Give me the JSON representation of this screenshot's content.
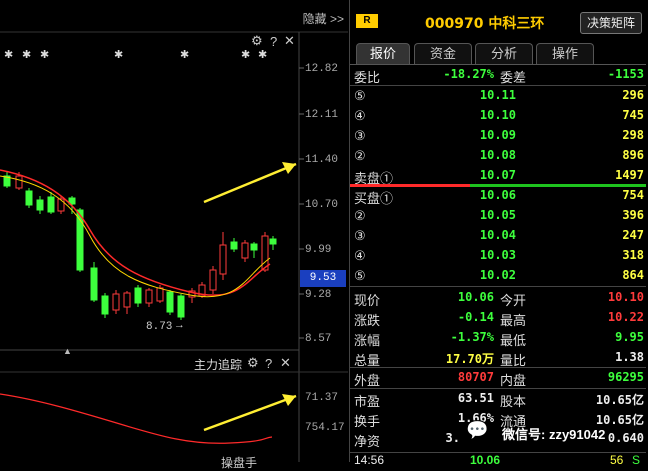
{
  "chart_panel": {
    "hide_label": "隐藏 >>",
    "y_ticks": [
      "12.82",
      "12.11",
      "11.40",
      "10.70",
      "9.99",
      "9.28",
      "8.57"
    ],
    "current_price_badge": "9.53",
    "low_label": "8.73",
    "sub_title": "主力追踪",
    "sub_ticks": [
      "71.37",
      "754.17"
    ],
    "bottom_partial": "操盘手"
  },
  "stock": {
    "badge": "R",
    "code_name": "000970 中科三环",
    "decision_button": "决策矩阵"
  },
  "tabs": [
    "报价",
    "资金",
    "分析",
    "操作"
  ],
  "commission": {
    "ratio_label": "委比",
    "ratio_value": "-18.27%",
    "diff_label": "委差",
    "diff_value": "-1153"
  },
  "sell_orders": [
    {
      "label": "⑤",
      "price": "10.11",
      "volume": "296"
    },
    {
      "label": "④",
      "price": "10.10",
      "volume": "745"
    },
    {
      "label": "③",
      "price": "10.09",
      "volume": "298"
    },
    {
      "label": "②",
      "price": "10.08",
      "volume": "896"
    },
    {
      "label": "卖盘①",
      "price": "10.07",
      "volume": "1497"
    }
  ],
  "buy_orders": [
    {
      "label": "买盘①",
      "price": "10.06",
      "volume": "754"
    },
    {
      "label": "②",
      "price": "10.05",
      "volume": "396"
    },
    {
      "label": "③",
      "price": "10.04",
      "volume": "247"
    },
    {
      "label": "④",
      "price": "10.03",
      "volume": "318"
    },
    {
      "label": "⑤",
      "price": "10.02",
      "volume": "864"
    }
  ],
  "quote": {
    "now_label": "现价",
    "now_value": "10.06",
    "open_label": "今开",
    "open_value": "10.10",
    "chg_label": "涨跌",
    "chg_value": "-0.14",
    "high_label": "最高",
    "high_value": "10.22",
    "pct_label": "涨幅",
    "pct_value": "-1.37%",
    "low_label": "最低",
    "low_value": "9.95",
    "vol_label": "总量",
    "vol_value": "17.70万",
    "vr_label": "量比",
    "vr_value": "1.38",
    "outer_label": "外盘",
    "outer_value": "80707",
    "inner_label": "内盘",
    "inner_value": "96295",
    "pe_label": "市盈",
    "pe_value": "63.51",
    "cap_label": "股本",
    "cap_value": "10.65亿",
    "turn_label": "换手",
    "turn_value": "1.66%",
    "flow_label": "流通",
    "flow_value": "10.65亿",
    "na_label": "净资",
    "na_value": "3.",
    "np_value": "0.640",
    "time_value": "14:56",
    "time_price": "10.06",
    "time_vol": "56",
    "time_flag": "S"
  },
  "watermark": "微信号: zzy91042",
  "colors": {
    "up": "#ff3b3b",
    "down": "#3dff3d",
    "ma_red": "#ff2a2a",
    "ma_yellow": "#ffd700",
    "arrow": "#ffee33"
  }
}
